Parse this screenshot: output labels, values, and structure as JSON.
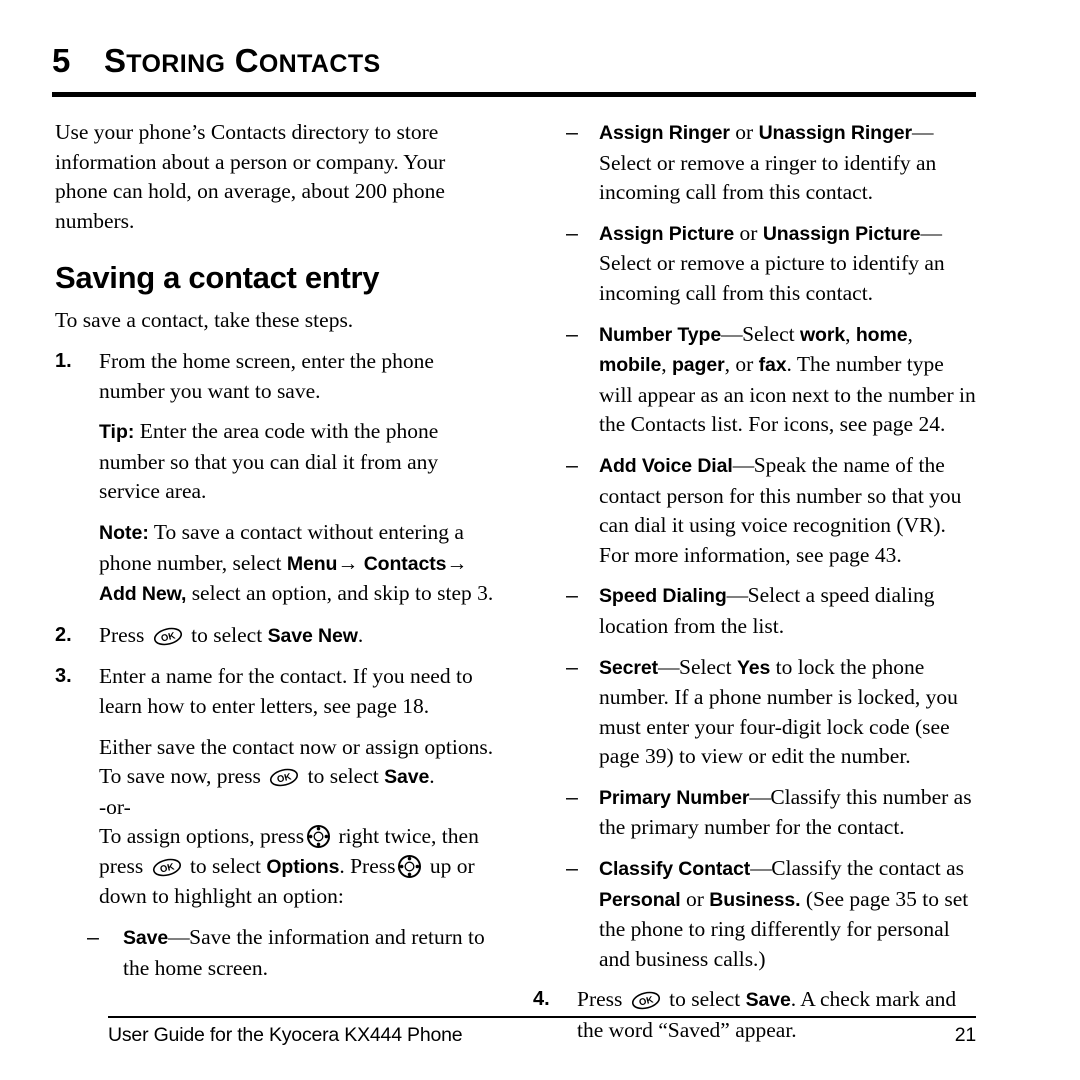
{
  "chapter": {
    "number": "5",
    "title": "Storing Contacts",
    "title_words": [
      "Storing",
      "Contacts"
    ]
  },
  "intro": "Use your phone’s Contacts directory to store information about a person or company. Your phone can hold, on average, about 200 phone numbers.",
  "section": {
    "heading": "Saving a contact entry",
    "lead": "To save a contact, take these steps."
  },
  "steps": {
    "step1": {
      "num": "1.",
      "text": "From the home screen, enter the phone number you want to save."
    },
    "tip": {
      "label": "Tip:",
      "text": "Enter the area code with the phone number so that you can dial it from any service area."
    },
    "note": {
      "label": "Note:",
      "text_a": "To save a contact without entering a phone number, select",
      "menu": "Menu",
      "arrow": "→",
      "contacts": "Contacts",
      "addnew": "Add New,",
      "text_b": "select an option, and skip to step 3."
    },
    "step2": {
      "num": "2.",
      "press": "Press",
      "to_select": "to select",
      "target": "Save New",
      "period": "."
    },
    "step3": {
      "num": "3.",
      "text": "Enter a name for the contact. If you need to learn how to enter letters, see page 18.",
      "either": "Either save the contact now or assign options. To save now, press",
      "to_select": "to select",
      "target": "Save",
      "period": ".",
      "or": "-or-",
      "assign_a": "To assign options, press",
      "assign_b": "right twice, then press",
      "assign_c": "to select",
      "options": "Options",
      "assign_d": ". Press",
      "assign_e": "up or down to highlight an option:"
    },
    "step4": {
      "num": "4.",
      "press": "Press",
      "to_select": "to select",
      "target": "Save",
      "rest": ". A check mark and the word “Saved” appear."
    }
  },
  "options_left": [
    {
      "dash": "–",
      "term": "Save",
      "emdash": "—",
      "desc": "Save the information and return to the home screen."
    }
  ],
  "options_right": [
    {
      "dash": "–",
      "term_a": "Assign Ringer",
      "conj": "or",
      "term_b": "Unassign Ringer",
      "emdash": "—",
      "desc": "Select or remove a ringer to identify an incoming call from this contact."
    },
    {
      "dash": "–",
      "term_a": "Assign Picture",
      "conj": "or",
      "term_b": "Unassign Picture",
      "emdash": "—",
      "desc": "Select or remove a picture to identify an incoming call from this contact."
    },
    {
      "dash": "–",
      "term": "Number Type",
      "emdash": "—",
      "desc_a": "Select",
      "v1": "work",
      "v2": "home",
      "v3": "mobile",
      "v4": "pager",
      "or": "or",
      "v5": "fax",
      "desc_b": ". The number type will appear as an icon next to the number in the Contacts list. For icons, see page 24."
    },
    {
      "dash": "–",
      "term": "Add Voice Dial",
      "emdash": "—",
      "desc": "Speak the name of the contact person for this number so that you can dial it using voice recognition (VR). For more information, see page 43."
    },
    {
      "dash": "–",
      "term": "Speed Dialing",
      "emdash": "—",
      "desc": "Select a speed dialing location from the list."
    },
    {
      "dash": "–",
      "term": "Secret",
      "emdash": "—",
      "desc_a": "Select",
      "yes": "Yes",
      "desc_b": "to lock the phone number. If a phone number is locked, you must enter your four-digit lock code (see page 39) to view or edit the number."
    },
    {
      "dash": "–",
      "term": "Primary Number",
      "emdash": "—",
      "desc": "Classify this number as the primary number for the contact."
    },
    {
      "dash": "–",
      "term": "Classify Contact",
      "emdash": "—",
      "desc_a": "Classify the contact as",
      "personal": "Personal",
      "or": "or",
      "business": "Business.",
      "desc_b": "(See page 35 to set the phone to ring differently for personal and business calls.)"
    }
  ],
  "icons": {
    "ok_key": "ok-key-icon",
    "nav_key": "navigation-key-icon"
  },
  "footer": {
    "left": "User Guide for the Kyocera KX444 Phone",
    "page": "21"
  }
}
